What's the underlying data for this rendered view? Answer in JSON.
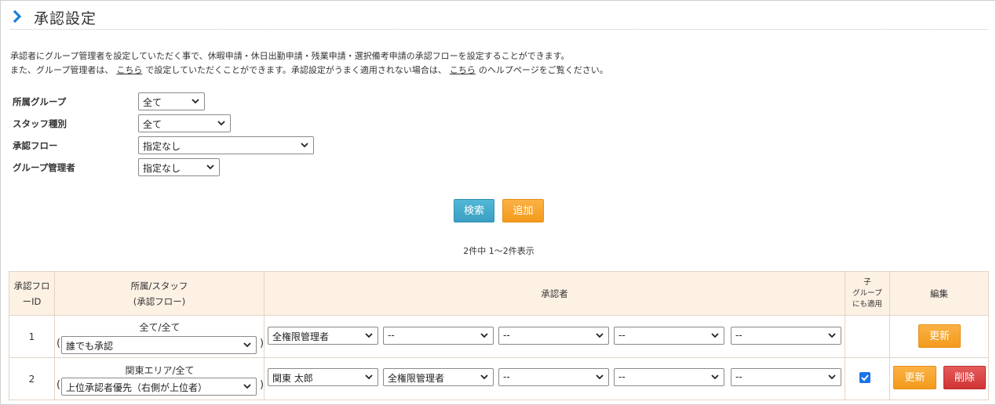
{
  "page": {
    "title": "承認設定",
    "description_line1": "承認者にグループ管理者を設定していただく事で、休暇申請・休日出勤申請・残業申請・選択備考申請の承認フローを設定することができます。",
    "description_line2_a": "また、グループ管理者は、",
    "description_link1": "こちら",
    "description_line2_b": "で設定していただくことができます。承認設定がうまく適用されない場合は、",
    "description_link2": "こちら",
    "description_line2_c": "のヘルプページをご覧ください。"
  },
  "filters": {
    "group_label": "所属グループ",
    "group_value": "全て",
    "staff_type_label": "スタッフ種別",
    "staff_type_value": "全て",
    "flow_label": "承認フロー",
    "flow_value": "指定なし",
    "group_admin_label": "グループ管理者",
    "group_admin_value": "指定なし"
  },
  "actions": {
    "search_label": "検索",
    "add_label": "追加"
  },
  "result_count": "2件中 1〜2件表示",
  "table": {
    "headers": {
      "flow_id": "承認フロ\nーID",
      "group_staff_line1": "所属/スタッフ",
      "group_staff_line2": "(承認フロー)",
      "approver": "承認者",
      "child_line1": "子",
      "child_line2": "グループ",
      "child_line3": "にも適用",
      "edit": "編集"
    },
    "rows": [
      {
        "id": "1",
        "group_staff": "全て/全て",
        "flow": "誰でも承認",
        "approvers": [
          "全権限管理者",
          "--",
          "--",
          "--",
          "--"
        ],
        "child_applied": false,
        "update_label": "更新"
      },
      {
        "id": "2",
        "group_staff": "関東エリア/全て",
        "flow": "上位承認者優先（右側が上位者）",
        "approvers": [
          "関東 太郎",
          "全権限管理者",
          "--",
          "--",
          "--"
        ],
        "child_applied": true,
        "update_label": "更新",
        "delete_label": "削除"
      }
    ]
  },
  "colors": {
    "accent": "#1a7fd8",
    "search_button": "#3ea6c8",
    "add_button": "#f6a028",
    "delete_button": "#d63c3c",
    "table_header": "#fdf1e4"
  },
  "icons": {
    "title": "chevron-right-icon",
    "select": "chevron-down-icon",
    "checkbox": "check-icon"
  }
}
